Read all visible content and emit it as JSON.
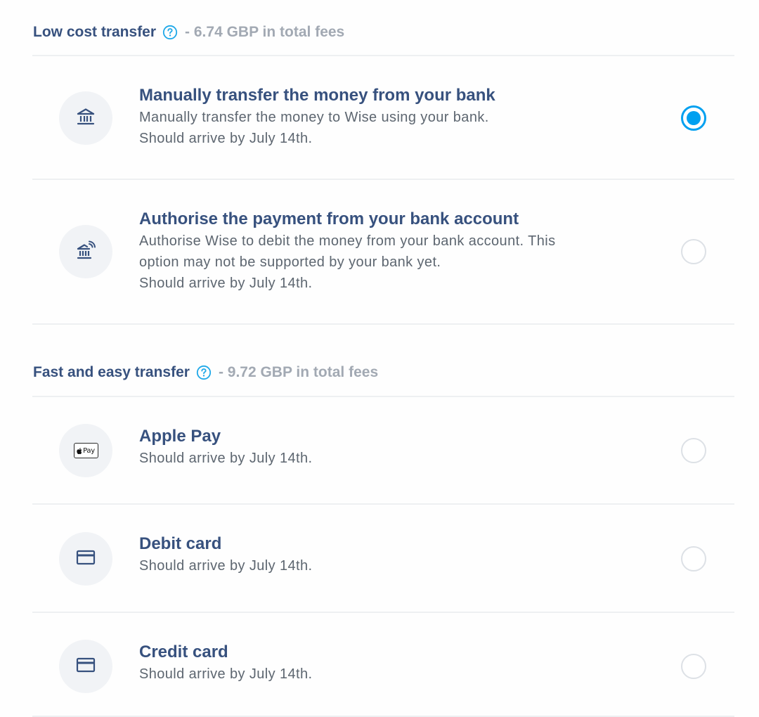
{
  "sections": [
    {
      "title": "Low cost transfer",
      "fee_text": "- 6.74 GBP in total fees",
      "help_icon": "question-circle-icon"
    },
    {
      "title": "Fast and easy transfer",
      "fee_text": "- 9.72 GBP in total fees",
      "help_icon": "question-circle-icon"
    }
  ],
  "options": [
    {
      "title": "Manually transfer the money from your bank",
      "desc_lines": [
        "Manually transfer the money to Wise using your bank.",
        "Should arrive by July 14th."
      ],
      "icon": "bank-icon",
      "selected": true
    },
    {
      "title": "Authorise the payment from your bank account",
      "desc_lines": [
        "Authorise Wise to debit the money from your bank account. This",
        "option may not be supported by your bank yet.",
        "Should arrive by July 14th."
      ],
      "icon": "bank-wireless-icon",
      "selected": false
    },
    {
      "title": "Apple Pay",
      "desc_lines": [
        "Should arrive by July 14th."
      ],
      "icon": "apple-pay-icon",
      "badge_text": "Pay",
      "selected": false
    },
    {
      "title": "Debit card",
      "desc_lines": [
        "Should arrive by July 14th."
      ],
      "icon": "card-icon",
      "selected": false
    },
    {
      "title": "Credit card",
      "desc_lines": [
        "Should arrive by July 14th."
      ],
      "icon": "card-icon",
      "selected": false
    }
  ],
  "colors": {
    "title": "#37517e",
    "muted": "#a2a9b3",
    "body": "#5d6670",
    "accent": "#00a0f0"
  }
}
